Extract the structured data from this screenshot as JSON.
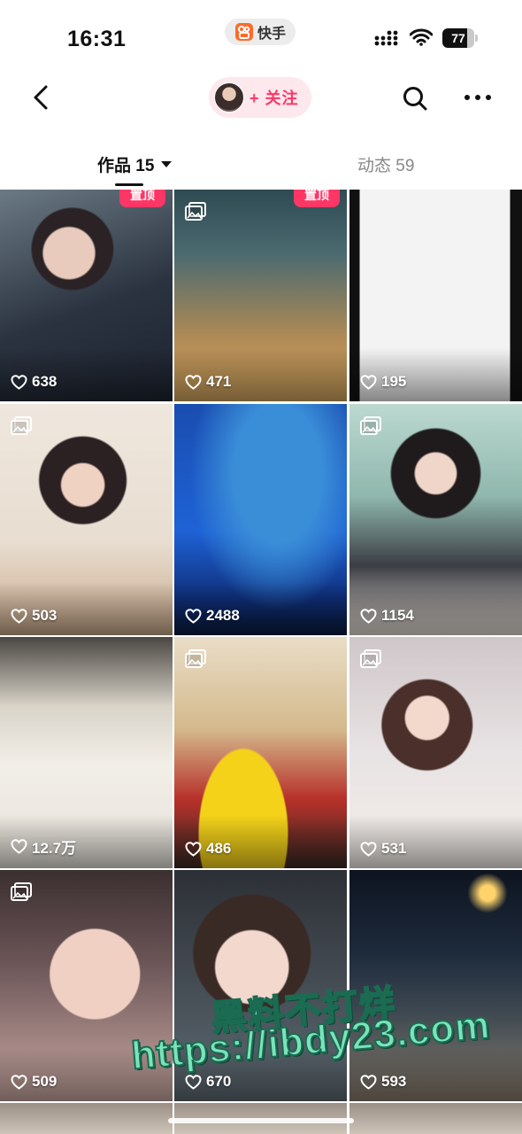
{
  "status_bar": {
    "time": "16:31",
    "app_name": "快手",
    "battery": "77",
    "battery_level": 0.77
  },
  "header": {
    "follow_label": "+ 关注"
  },
  "tabs": [
    {
      "label": "作品 15",
      "active": true
    },
    {
      "label": "动态 59",
      "active": false
    }
  ],
  "pin_label": "置顶",
  "videos": [
    {
      "likes": "638",
      "pinned": true,
      "album": false,
      "thumb": "selfie-polaroid"
    },
    {
      "likes": "471",
      "pinned": true,
      "album": true,
      "thumb": "phone-selfie"
    },
    {
      "likes": "195",
      "pinned": false,
      "album": false,
      "thumb": "chat-screenshot"
    },
    {
      "likes": "503",
      "pinned": false,
      "album": true,
      "thumb": "girl-bread"
    },
    {
      "likes": "2488",
      "pinned": false,
      "album": false,
      "thumb": "aquarium-silhouettes"
    },
    {
      "likes": "1154",
      "pinned": false,
      "album": true,
      "thumb": "girl-cake"
    },
    {
      "likes": "12.7万",
      "pinned": false,
      "album": false,
      "thumb": "kitchen-cakes"
    },
    {
      "likes": "486",
      "pinned": false,
      "album": true,
      "thumb": "girl-yellow-table"
    },
    {
      "likes": "531",
      "pinned": false,
      "album": true,
      "thumb": "bunny-ears-mirror"
    },
    {
      "likes": "509",
      "pinned": false,
      "album": true,
      "thumb": "girl-closeup"
    },
    {
      "likes": "670",
      "pinned": false,
      "album": false,
      "thumb": "girl-portrait"
    },
    {
      "likes": "593",
      "pinned": false,
      "album": false,
      "thumb": "street-night"
    },
    {
      "likes": "",
      "pinned": false,
      "album": false,
      "thumb": "partial-row"
    },
    {
      "likes": "",
      "pinned": false,
      "album": false,
      "thumb": "partial-row"
    },
    {
      "likes": "",
      "pinned": false,
      "album": false,
      "thumb": "partial-row"
    }
  ],
  "watermark": {
    "line1": "黑料不打烊",
    "line2": "https://ibdy23.com"
  },
  "colors": {
    "accent": "#fe3666",
    "follow_bg": "#fde8ed",
    "watermark": "#7be3b9"
  },
  "icons": [
    "back-arrow-icon",
    "search-icon",
    "more-dots-icon",
    "heart-icon",
    "album-icon",
    "wifi-icon",
    "signal-icon",
    "battery-icon"
  ]
}
